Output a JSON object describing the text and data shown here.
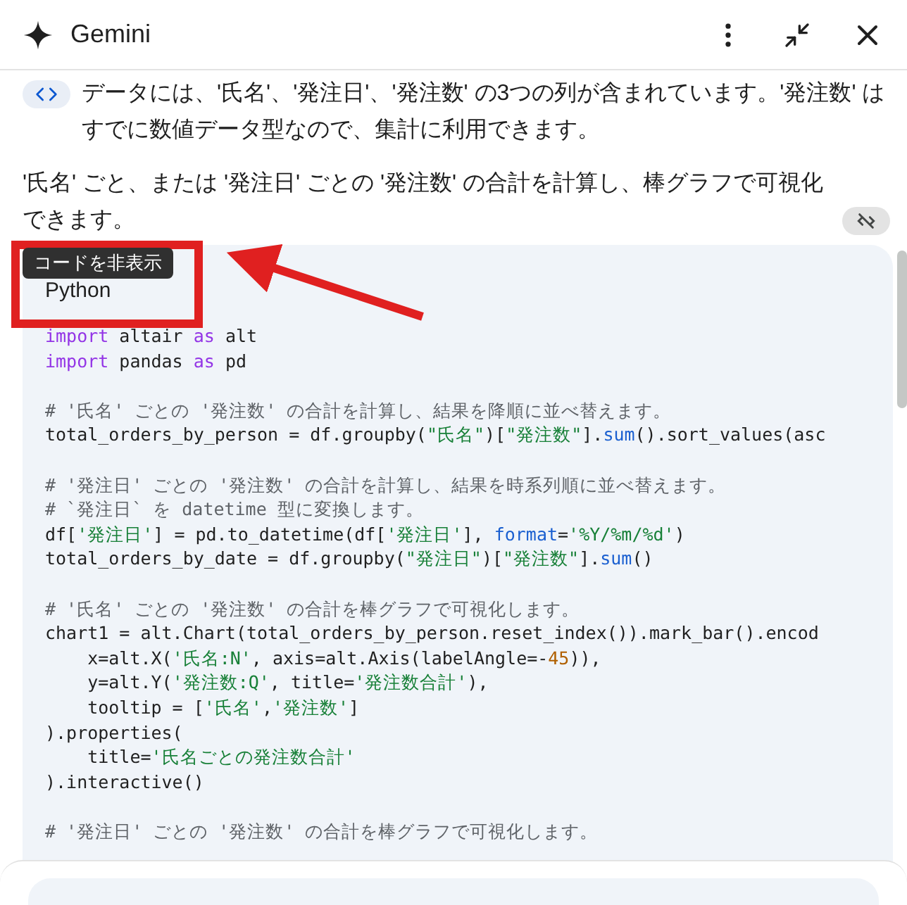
{
  "header": {
    "title": "Gemini"
  },
  "paragraphs": [
    "データには、'氏名'、'発注日'、'発注数' の3つの列が含まれています。'発注数' はすでに数値データ型なので、集計に利用できます。",
    "'氏名' ごと、または '発注日' ごとの '発注数' の合計を計算し、棒グラフで可視化できます。"
  ],
  "code_toggle": {
    "tooltip": "コードを非表示"
  },
  "code_block": {
    "language": "Python",
    "lines": [
      {
        "kind": "code",
        "tokens": [
          {
            "kind": "kw",
            "text": "import"
          },
          {
            "kind": "plain",
            "text": " altair "
          },
          {
            "kind": "kw",
            "text": "as"
          },
          {
            "kind": "plain",
            "text": " alt"
          }
        ]
      },
      {
        "kind": "code",
        "tokens": [
          {
            "kind": "kw",
            "text": "import"
          },
          {
            "kind": "plain",
            "text": " pandas "
          },
          {
            "kind": "kw",
            "text": "as"
          },
          {
            "kind": "plain",
            "text": " pd"
          }
        ]
      },
      {
        "kind": "blank"
      },
      {
        "kind": "code",
        "tokens": [
          {
            "kind": "comment",
            "text": "# '氏名' ごとの '発注数' の合計を計算し、結果を降順に並べ替えます。"
          }
        ]
      },
      {
        "kind": "code",
        "tokens": [
          {
            "kind": "plain",
            "text": "total_orders_by_person = df.groupby("
          },
          {
            "kind": "str",
            "text": "\"氏名\""
          },
          {
            "kind": "plain",
            "text": ")["
          },
          {
            "kind": "str",
            "text": "\"発注数\""
          },
          {
            "kind": "plain",
            "text": "]."
          },
          {
            "kind": "func",
            "text": "sum"
          },
          {
            "kind": "plain",
            "text": "().sort_values(asc"
          }
        ]
      },
      {
        "kind": "blank"
      },
      {
        "kind": "code",
        "tokens": [
          {
            "kind": "comment",
            "text": "# '発注日' ごとの '発注数' の合計を計算し、結果を時系列順に並べ替えます。"
          }
        ]
      },
      {
        "kind": "code",
        "tokens": [
          {
            "kind": "comment",
            "text": "# `発注日` を datetime 型に変換します。"
          }
        ]
      },
      {
        "kind": "code",
        "tokens": [
          {
            "kind": "plain",
            "text": "df["
          },
          {
            "kind": "str",
            "text": "'発注日'"
          },
          {
            "kind": "plain",
            "text": "] = pd.to_datetime(df["
          },
          {
            "kind": "str",
            "text": "'発注日'"
          },
          {
            "kind": "plain",
            "text": "], "
          },
          {
            "kind": "func",
            "text": "format"
          },
          {
            "kind": "plain",
            "text": "="
          },
          {
            "kind": "str",
            "text": "'%Y/%m/%d'"
          },
          {
            "kind": "plain",
            "text": ")"
          }
        ]
      },
      {
        "kind": "code",
        "tokens": [
          {
            "kind": "plain",
            "text": "total_orders_by_date = df.groupby("
          },
          {
            "kind": "str",
            "text": "\"発注日\""
          },
          {
            "kind": "plain",
            "text": ")["
          },
          {
            "kind": "str",
            "text": "\"発注数\""
          },
          {
            "kind": "plain",
            "text": "]."
          },
          {
            "kind": "func",
            "text": "sum"
          },
          {
            "kind": "plain",
            "text": "()"
          }
        ]
      },
      {
        "kind": "blank"
      },
      {
        "kind": "code",
        "tokens": [
          {
            "kind": "comment",
            "text": "# '氏名' ごとの '発注数' の合計を棒グラフで可視化します。"
          }
        ]
      },
      {
        "kind": "code",
        "tokens": [
          {
            "kind": "plain",
            "text": "chart1 = alt.Chart(total_orders_by_person.reset_index()).mark_bar().encod"
          }
        ]
      },
      {
        "kind": "code",
        "tokens": [
          {
            "kind": "plain",
            "text": "    x=alt.X("
          },
          {
            "kind": "str",
            "text": "'氏名:N'"
          },
          {
            "kind": "plain",
            "text": ", axis=alt.Axis(labelAngle=-"
          },
          {
            "kind": "num",
            "text": "45"
          },
          {
            "kind": "plain",
            "text": ")),"
          }
        ]
      },
      {
        "kind": "code",
        "tokens": [
          {
            "kind": "plain",
            "text": "    y=alt.Y("
          },
          {
            "kind": "str",
            "text": "'発注数:Q'"
          },
          {
            "kind": "plain",
            "text": ", title="
          },
          {
            "kind": "str",
            "text": "'発注数合計'"
          },
          {
            "kind": "plain",
            "text": "),"
          }
        ]
      },
      {
        "kind": "code",
        "tokens": [
          {
            "kind": "plain",
            "text": "    tooltip = ["
          },
          {
            "kind": "str",
            "text": "'氏名'"
          },
          {
            "kind": "plain",
            "text": ","
          },
          {
            "kind": "str",
            "text": "'発注数'"
          },
          {
            "kind": "plain",
            "text": "]"
          }
        ]
      },
      {
        "kind": "code",
        "tokens": [
          {
            "kind": "plain",
            "text": ").properties("
          }
        ]
      },
      {
        "kind": "code",
        "tokens": [
          {
            "kind": "plain",
            "text": "    title="
          },
          {
            "kind": "str",
            "text": "'氏名ごとの発注数合計'"
          }
        ]
      },
      {
        "kind": "code",
        "tokens": [
          {
            "kind": "plain",
            "text": ").interactive()"
          }
        ]
      },
      {
        "kind": "blank"
      },
      {
        "kind": "code",
        "tokens": [
          {
            "kind": "comment",
            "text": "# '発注日' ごとの '発注数' の合計を棒グラフで可視化します。"
          }
        ]
      }
    ]
  }
}
